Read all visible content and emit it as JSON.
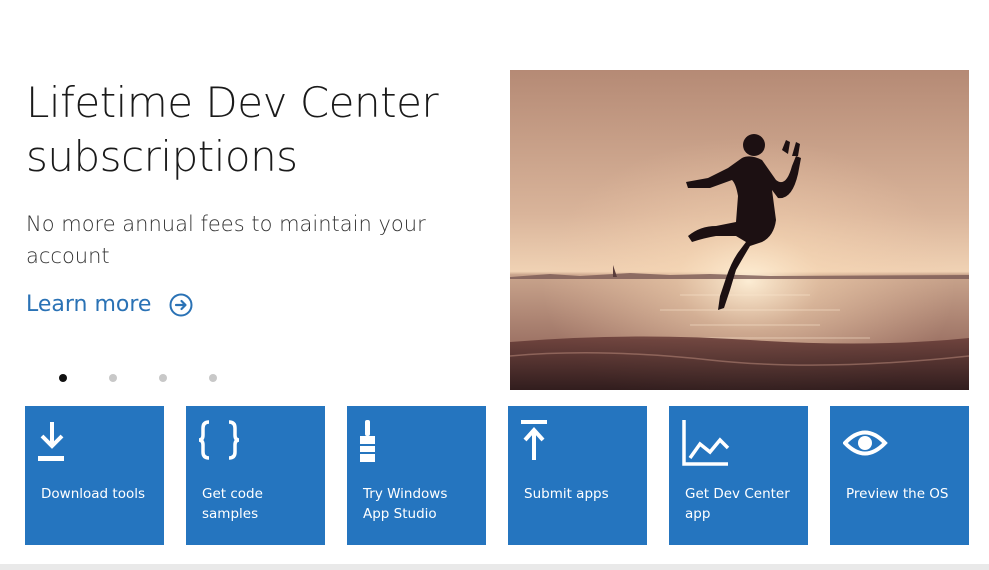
{
  "hero": {
    "title": "Lifetime Dev Center subscriptions",
    "subtitle": "No more annual fees to maintain your account",
    "learn_more": "Learn more"
  },
  "carousel": {
    "slide_count": 4,
    "active_index": 0
  },
  "tiles": [
    {
      "label": "Download tools",
      "icon": "download-icon"
    },
    {
      "label": "Get code samples",
      "icon": "braces-icon"
    },
    {
      "label": "Try Windows App Studio",
      "icon": "paintbrush-icon"
    },
    {
      "label": "Submit apps",
      "icon": "upload-icon"
    },
    {
      "label": "Get Dev Center app",
      "icon": "line-chart-icon"
    },
    {
      "label": "Preview the OS",
      "icon": "eye-icon"
    }
  ],
  "colors": {
    "tile_background": "#2575bf",
    "link": "#2a72b5",
    "active_dot": "#111111",
    "inactive_dot": "#c8c8c8"
  }
}
